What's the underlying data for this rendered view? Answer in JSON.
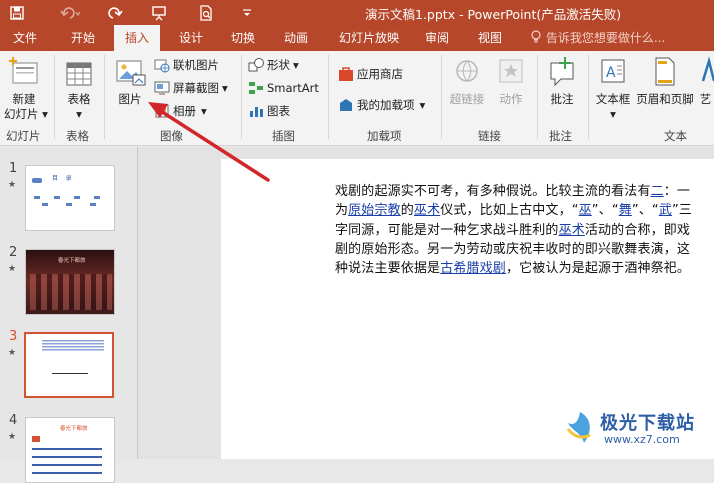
{
  "window": {
    "title": "演示文稿1.pptx - PowerPoint(产品激活失败)",
    "title_bg": "#b7472a"
  },
  "tabs": [
    {
      "label": "文件",
      "active": false
    },
    {
      "label": "开始",
      "active": false
    },
    {
      "label": "插入",
      "active": true
    },
    {
      "label": "设计",
      "active": false
    },
    {
      "label": "切换",
      "active": false
    },
    {
      "label": "动画",
      "active": false
    },
    {
      "label": "幻灯片放映",
      "active": false
    },
    {
      "label": "审阅",
      "active": false
    },
    {
      "label": "视图",
      "active": false
    }
  ],
  "tell_me": "告诉我您想要做什么...",
  "ribbon": {
    "new_slide": {
      "line1": "新建",
      "line2": "幻灯片"
    },
    "table": "表格",
    "picture": "图片",
    "online_picture": "联机图片",
    "screenshot": "屏幕截图",
    "album": "相册",
    "shapes": "形状",
    "smartart": "SmartArt",
    "chart": "图表",
    "store": "应用商店",
    "my_addins": "我的加载项",
    "hyperlink": "超链接",
    "action": "动作",
    "comment": "批注",
    "textbox": "文本框",
    "header_footer": "页眉和页脚",
    "wordart": "艺",
    "groups": {
      "slides": "幻灯片",
      "tables": "表格",
      "images": "图像",
      "illustrations": "插图",
      "addins": "加载项",
      "links": "链接",
      "comments": "批注",
      "text": "文本"
    }
  },
  "slides": [
    {
      "num": "1",
      "thumb_title": "目    录"
    },
    {
      "num": "2",
      "thumb_title": "春光下都旅"
    },
    {
      "num": "3",
      "selected": true
    },
    {
      "num": "4",
      "thumb_title": "春光下都旅"
    }
  ],
  "body": {
    "p1": "戏剧的起源实不可考，有多种假说。比较主流的看法有",
    "p2_link": "二",
    "p3": "：一为",
    "link_religion": "原始宗教",
    "p4": "的",
    "link_wushu1": "巫术",
    "p5": "仪式，比如上古中文，",
    "q1": "“",
    "link_wu1": "巫",
    "q2": "”、",
    "q3": "“",
    "link_wu2": "舞",
    "q4": "”、“",
    "link_wu3": "武",
    "p6": "”三字同源，可能是对一种乞求战斗胜利的",
    "link_wushu2": "巫术",
    "p7": "活动的合称，即戏剧的原始形态。另一为劳动或庆祝丰收时的即兴歌舞表演，这种说法主要依据是",
    "link_greek": "古希腊戏剧",
    "p8": "，它被认为是起源于酒神祭祀。"
  },
  "watermark": {
    "text": "极光下载站",
    "url": "www.xz7.com"
  }
}
